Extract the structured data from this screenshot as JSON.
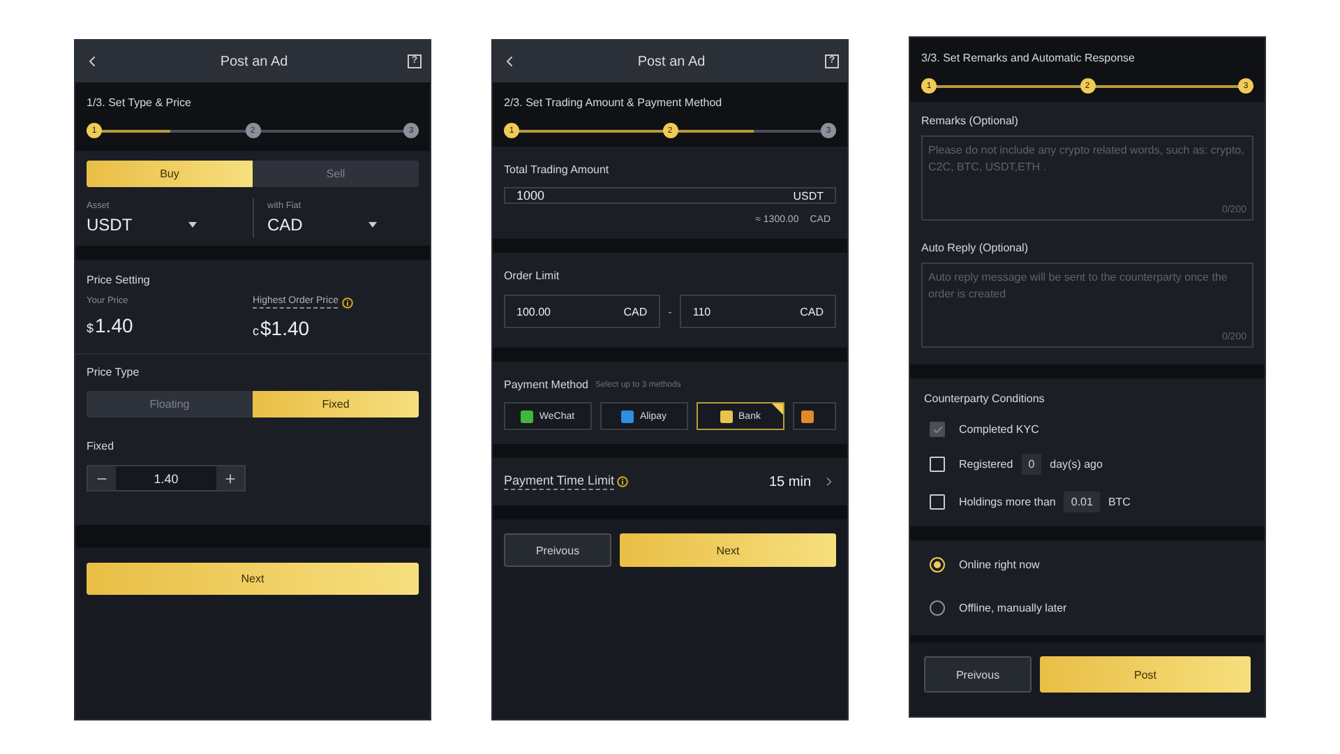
{
  "screen_1": {
    "header": {
      "title": "Post an Ad",
      "help": "?"
    },
    "stepper": {
      "title": "1/3. Set Type & Price",
      "level": 0.25,
      "steps": [
        {
          "label": "1",
          "done": true
        },
        {
          "label": "2",
          "done": false
        },
        {
          "label": "3",
          "done": false
        }
      ]
    },
    "side_tabs": [
      {
        "label": "Buy",
        "selected": true
      },
      {
        "label": "Sell",
        "selected": false
      }
    ],
    "asset": {
      "label": "Asset",
      "value": "USDT"
    },
    "fiat": {
      "label": "with Fiat",
      "value": "CAD"
    },
    "price_setting": {
      "title": "Price Setting",
      "your_price": {
        "label": "Your Price",
        "currency": "$",
        "value": "1.40"
      },
      "highest_price": {
        "label": "Highest Order Price",
        "currency": "c",
        "value": "$1.40"
      }
    },
    "price_type": {
      "title": "Price Type",
      "options": [
        {
          "label": "Floating",
          "selected": false
        },
        {
          "label": "Fixed",
          "selected": true
        }
      ]
    },
    "fixed": {
      "label": "Fixed",
      "value": "1.40"
    },
    "next_button": "Next"
  },
  "screen_2": {
    "header": {
      "title": "Post an Ad",
      "help": "?"
    },
    "stepper": {
      "title": "2/3. Set Trading Amount & Payment Method",
      "level": 0.75,
      "steps": [
        {
          "label": "1",
          "done": true
        },
        {
          "label": "2",
          "done": true
        },
        {
          "label": "3",
          "done": false
        }
      ]
    },
    "total_amount": {
      "label": "Total Trading Amount",
      "value": "1000",
      "unit": "USDT",
      "converted": "≈ 1300.00",
      "converted_unit": "CAD"
    },
    "order_limit": {
      "label": "Order Limit",
      "min": {
        "value": "100.00",
        "unit": "CAD"
      },
      "separator": "-",
      "max": {
        "value": "110",
        "unit": "CAD"
      }
    },
    "payment": {
      "title": "Payment Method",
      "hint": "Select up to 3 methods",
      "methods": [
        {
          "label": "WeChat",
          "selected": false,
          "color": "#3fb83a"
        },
        {
          "label": "Alipay",
          "selected": false,
          "color": "#2f8fe0"
        },
        {
          "label": "Bank",
          "selected": true,
          "color": "#e9c24c"
        },
        {
          "selected": false,
          "color": "#e38a2c"
        }
      ]
    },
    "time_limit": {
      "label": "Payment Time Limit",
      "value": "15 min"
    },
    "buttons": {
      "previous": "Preivous",
      "next": "Next"
    }
  },
  "screen_3": {
    "stepper": {
      "title": "3/3. Set Remarks and Automatic Response",
      "level": 1,
      "steps": [
        {
          "label": "1",
          "done": true
        },
        {
          "label": "2",
          "done": true
        },
        {
          "label": "3",
          "done": true
        }
      ]
    },
    "remarks": {
      "label": "Remarks (Optional)",
      "placeholder": "Please do not include any crypto related words, such as: crypto, C2C, BTC, USDT,ETH .",
      "counter": "0/200"
    },
    "auto_reply": {
      "label": "Auto Reply (Optional)",
      "placeholder": "Auto reply message will be sent to the counterparty once the order is created",
      "counter": "0/200"
    },
    "conditions": {
      "title": "Counterparty Conditions",
      "items": [
        {
          "kind": "plain",
          "label": "Completed KYC",
          "checked": true,
          "disabled": true
        },
        {
          "kind": "input",
          "label": "Registered",
          "value": "0",
          "suffix": "day(s) ago",
          "checked": false,
          "disabled": false
        },
        {
          "kind": "input",
          "label": "Holdings more than",
          "value": "0.01",
          "suffix": "BTC",
          "checked": false,
          "disabled": false
        }
      ]
    },
    "status": [
      {
        "label": "Online right now",
        "selected": true
      },
      {
        "label": "Offline, manually later",
        "selected": false
      }
    ],
    "buttons": {
      "previous": "Preivous",
      "post": "Post"
    }
  }
}
